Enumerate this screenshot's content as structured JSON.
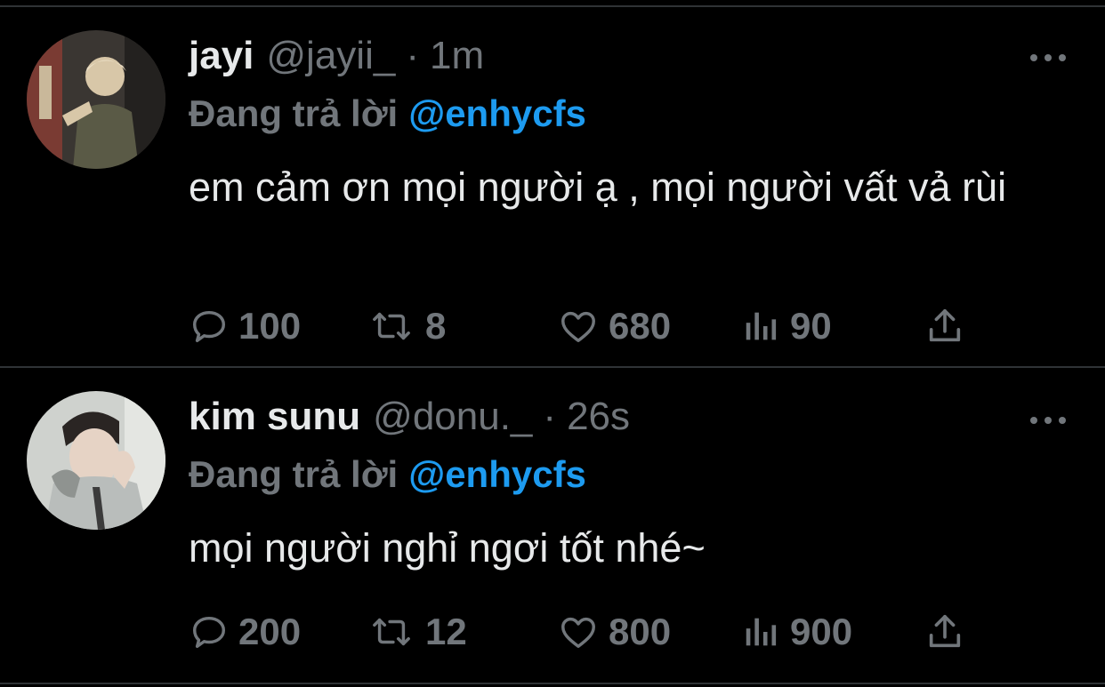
{
  "tweets": [
    {
      "name": "jayi",
      "handle": "@jayii_",
      "dot": "·",
      "time": "1m",
      "reply_label": "Đang trả lời",
      "reply_to": "@enhycfs",
      "text": "em cảm ơn mọi người ạ , mọi người vất vả rùi",
      "replies": "100",
      "retweets": "8",
      "likes": "680",
      "views": "90"
    },
    {
      "name": "kim sunu",
      "handle": "@donu._",
      "dot": "·",
      "time": "26s",
      "reply_label": "Đang trả lời",
      "reply_to": "@enhycfs",
      "text": "mọi người nghỉ ngơi tốt nhé~",
      "replies": "200",
      "retweets": "12",
      "likes": "800",
      "views": "900"
    }
  ],
  "colors": {
    "background": "#000000",
    "text": "#e7e9ea",
    "muted": "#71767b",
    "accent": "#1d9bf0",
    "divider": "#2f3336"
  },
  "icons": [
    "reply-icon",
    "retweet-icon",
    "like-icon",
    "views-icon",
    "share-icon",
    "more-icon"
  ]
}
